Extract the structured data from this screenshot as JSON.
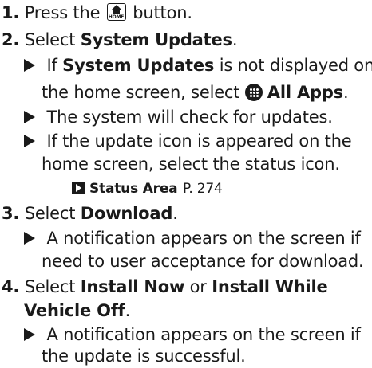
{
  "steps": {
    "s1": {
      "number": "1.",
      "pre": "Press the",
      "icon_label": "HOME",
      "post": "button."
    },
    "s2": {
      "number": "2.",
      "pre": "Select",
      "bold": "System Updates",
      "post": ".",
      "note1": {
        "pre": "If",
        "bold": "System Updates",
        "post": "is not displayed on",
        "line2_pre": "the home screen, select",
        "bold2": "All Apps",
        "line2_post": "."
      },
      "note2": "The system will check for updates.",
      "note3": {
        "line1": "If the update icon is appeared on the",
        "line2": "home screen, select the status icon."
      },
      "xref": {
        "bold": "Status Area",
        "page": "P. 274"
      }
    },
    "s3": {
      "number": "3.",
      "pre": "Select",
      "bold": "Download",
      "post": ".",
      "note": {
        "line1": "A notification appears on the screen if",
        "line2": "need to user acceptance for download."
      }
    },
    "s4": {
      "number": "4.",
      "pre": "Select",
      "bold1": "Install Now",
      "mid": "or",
      "bold2": "Install While",
      "bold2_line2": "Vehicle Off",
      "post": ".",
      "note": {
        "line1": "A notification appears on the screen if",
        "line2": "the update is successful."
      }
    }
  },
  "icons": {
    "home": "home-button-icon",
    "apps": "all-apps-icon",
    "xref": "cross-reference-arrow-icon",
    "bullet": "triangle-bullet-icon"
  }
}
